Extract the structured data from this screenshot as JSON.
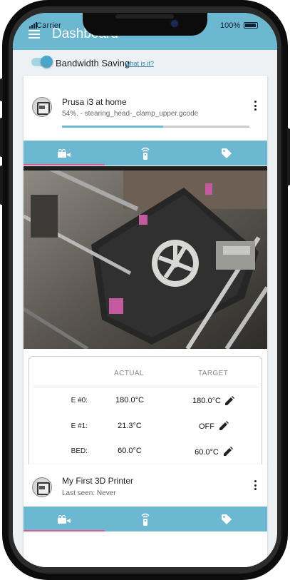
{
  "status_bar": {
    "carrier": "Carrier",
    "battery": "100%"
  },
  "app_bar": {
    "title": "Dashboard"
  },
  "bandwidth": {
    "label": "Bandwidth Saving",
    "link": "what is it?",
    "enabled": true
  },
  "printers": [
    {
      "name": "Prusa i3 at home",
      "status": "54%. - stearing_head-_clamp_upper.gcode",
      "progress_percent": 54,
      "active_tab": "camera",
      "tabs": [
        "camera-icon",
        "remote-icon",
        "tag-icon"
      ],
      "temps": {
        "headers": {
          "actual": "ACTUAL",
          "target": "TARGET"
        },
        "rows": [
          {
            "label": "E #0:",
            "actual": "180.0°C",
            "target": "180.0°C"
          },
          {
            "label": "E #1:",
            "actual": "21.3°C",
            "target": "OFF"
          },
          {
            "label": "BED:",
            "actual": "60.0°C",
            "target": "60.0°C"
          }
        ]
      }
    },
    {
      "name": "My First 3D Printer",
      "status": "Last seen: Never",
      "active_tab": "camera",
      "tabs": [
        "camera-icon",
        "remote-icon",
        "tag-icon"
      ]
    }
  ],
  "colors": {
    "accent": "#6cb8d1",
    "tab_indicator": "#e05a8a"
  }
}
